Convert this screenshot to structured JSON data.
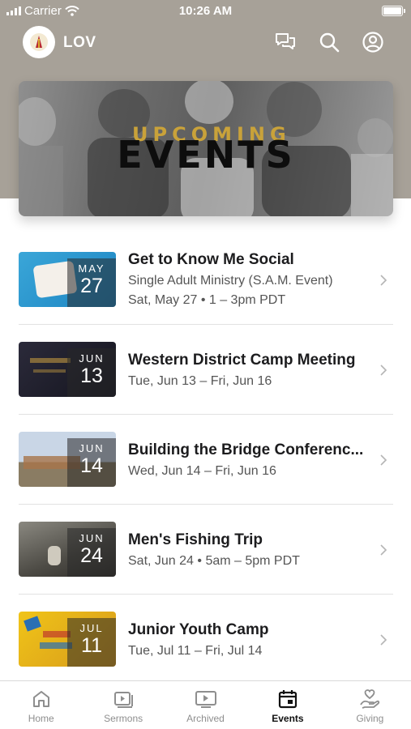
{
  "status_bar": {
    "carrier": "Carrier",
    "time": "10:26 AM"
  },
  "header": {
    "title": "LOV",
    "icons": [
      "chat-icon",
      "search-icon",
      "account-icon"
    ]
  },
  "banner": {
    "subtitle": "UPCOMING",
    "title": "EVENTS"
  },
  "events": [
    {
      "title": "Get to Know Me Social",
      "line1": "Single Adult Ministry (S.A.M. Event)",
      "line2": "Sat, May 27 • 1 – 3pm PDT",
      "month": "MAY",
      "day": "27",
      "thumb_colors": [
        "#3aa6d8",
        "#1c84c2"
      ]
    },
    {
      "title": "Western District Camp Meeting",
      "line1": "Tue, Jun 13 – Fri, Jun 16",
      "line2": "",
      "month": "JUN",
      "day": "13",
      "thumb_colors": [
        "#2b2a3a",
        "#14141e"
      ]
    },
    {
      "title": "Building the Bridge Conferenc...",
      "line1": "Wed, Jun 14 – Fri, Jun 16",
      "line2": "",
      "month": "JUN",
      "day": "14",
      "thumb_colors": [
        "#c9d6e6",
        "#8a7c63"
      ]
    },
    {
      "title": "Men's Fishing Trip",
      "line1": "Sat, Jun 24 • 5am – 5pm PDT",
      "line2": "",
      "month": "JUN",
      "day": "24",
      "thumb_colors": [
        "#6d6a62",
        "#2f2d29"
      ]
    },
    {
      "title": "Junior Youth Camp",
      "line1": "Tue, Jul 11 – Fri, Jul 14",
      "line2": "",
      "month": "JUL",
      "day": "11",
      "thumb_colors": [
        "#f0c419",
        "#d79a1a"
      ]
    }
  ],
  "tabs": [
    {
      "label": "Home",
      "icon": "home-icon",
      "active": false
    },
    {
      "label": "Sermons",
      "icon": "sermons-icon",
      "active": false
    },
    {
      "label": "Archived",
      "icon": "archived-icon",
      "active": false
    },
    {
      "label": "Events",
      "icon": "calendar-icon",
      "active": true
    },
    {
      "label": "Giving",
      "icon": "giving-icon",
      "active": false
    }
  ],
  "colors": {
    "header_band": "#a7a198",
    "accent_gold": "#c9a23a",
    "tab_inactive": "#8e8e8e",
    "tab_active": "#111111"
  }
}
